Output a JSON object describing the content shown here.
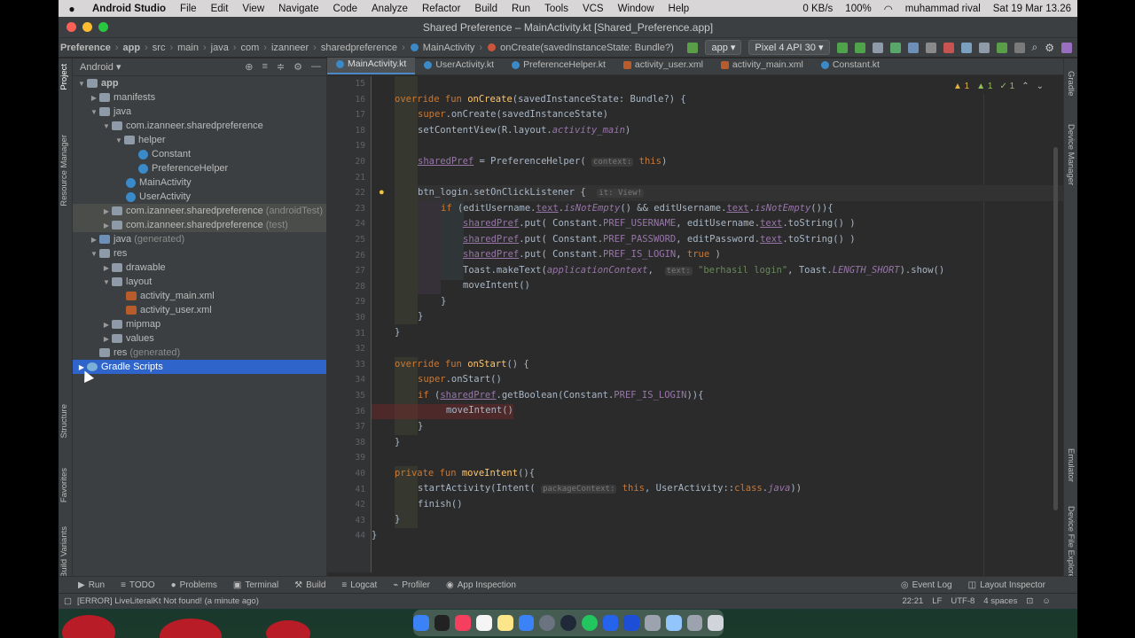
{
  "menubar": {
    "app": "Android Studio",
    "items": [
      "File",
      "Edit",
      "View",
      "Navigate",
      "Code",
      "Analyze",
      "Refactor",
      "Build",
      "Run",
      "Tools",
      "VCS",
      "Window",
      "Help"
    ],
    "net": "0 KB/s",
    "battery": "100%",
    "user": "muhammad rival",
    "datetime": "Sat 19 Mar  13.26"
  },
  "window": {
    "title": "Shared Preference – MainActivity.kt [Shared_Preference.app]"
  },
  "breadcrumbs": [
    "Preference",
    "app",
    "src",
    "main",
    "java",
    "com",
    "izanneer",
    "sharedpreference",
    "MainActivity",
    "onCreate(savedInstanceState: Bundle?)"
  ],
  "toolbar": {
    "config": "app",
    "device": "Pixel 4 API 30"
  },
  "left_strip": [
    "Project",
    "Resource Manager",
    "Structure",
    "Favorites",
    "Build Variants"
  ],
  "right_strip": [
    "Gradle",
    "Device Manager",
    "Emulator",
    "Device File Explorer"
  ],
  "project": {
    "view": "Android",
    "tree": [
      {
        "label": "app",
        "bold": true
      },
      {
        "label": "manifests"
      },
      {
        "label": "java"
      },
      {
        "label": "com.izanneer.sharedpreference"
      },
      {
        "label": "helper"
      },
      {
        "label": "Constant"
      },
      {
        "label": "PreferenceHelper"
      },
      {
        "label": "MainActivity"
      },
      {
        "label": "UserActivity"
      },
      {
        "label": "com.izanneer.sharedpreference",
        "suffix": "(androidTest)"
      },
      {
        "label": "com.izanneer.sharedpreference",
        "suffix": "(test)"
      },
      {
        "label": "java",
        "suffix": "(generated)"
      },
      {
        "label": "res"
      },
      {
        "label": "drawable"
      },
      {
        "label": "layout"
      },
      {
        "label": "activity_main.xml"
      },
      {
        "label": "activity_user.xml"
      },
      {
        "label": "mipmap"
      },
      {
        "label": "values"
      },
      {
        "label": "res",
        "suffix": "(generated)"
      },
      {
        "label": "Gradle Scripts"
      }
    ]
  },
  "tabs": [
    "MainActivity.kt",
    "UserActivity.kt",
    "PreferenceHelper.kt",
    "activity_user.xml",
    "activity_main.xml",
    "Constant.kt"
  ],
  "inspection": {
    "warnings": "1",
    "weak": "1",
    "typos": "1"
  },
  "code": {
    "line_numbers": [
      "15",
      "16",
      "17",
      "18",
      "19",
      "20",
      "21",
      "22",
      "23",
      "24",
      "25",
      "26",
      "27",
      "28",
      "29",
      "30",
      "31",
      "32",
      "33",
      "34",
      "35",
      "36",
      "37",
      "38",
      "39",
      "40",
      "41",
      "42",
      "43",
      "44"
    ],
    "l16": [
      "override fun ",
      "onCreate",
      "(savedInstanceState: Bundle?) {"
    ],
    "l17": [
      "super",
      ".onCreate(savedInstanceState)"
    ],
    "l18": [
      "setContentView(R.layout.",
      "activity_main",
      ")"
    ],
    "l20": [
      "sharedPref",
      " = PreferenceHelper( ",
      "context:",
      " this",
      ")"
    ],
    "l22": [
      "btn_login.setOnClickListener {",
      "it: View!"
    ],
    "l23": [
      "if",
      " (editUsername.",
      "text",
      ".",
      "isNotEmpty",
      "() && editUsername.",
      "text",
      ".",
      "isNotEmpty",
      "()){"
    ],
    "l24": [
      "sharedPref",
      ".put( Constant.",
      "PREF_USERNAME",
      ", editUsername.",
      "text",
      ".toString() )"
    ],
    "l25": [
      "sharedPref",
      ".put( Constant.",
      "PREF_PASSWORD",
      ", editPassword.",
      "text",
      ".toString() )"
    ],
    "l26": [
      "sharedPref",
      ".put( Constant.",
      "PREF_IS_LOGIN",
      ", ",
      "true",
      " )"
    ],
    "l27": [
      "Toast.makeText(",
      "applicationContext",
      ",",
      "text:",
      " \"berhasil login\"",
      ", Toast.",
      "LENGTH_SHORT",
      ").show()"
    ],
    "l28": [
      "moveIntent()"
    ],
    "l29": [
      "}"
    ],
    "l30": [
      "}"
    ],
    "l31": [
      "}"
    ],
    "l33": [
      "override fun ",
      "onStart",
      "() {"
    ],
    "l34": [
      "super",
      ".onStart()"
    ],
    "l35": [
      "if",
      " (",
      "sharedPref",
      ".getBoolean(Constant.",
      "PREF_IS_LOGIN",
      ")){"
    ],
    "l36": [
      "moveIntent()"
    ],
    "l37": [
      "}"
    ],
    "l38": [
      "}"
    ],
    "l40": [
      "private fun ",
      "moveIntent",
      "(){"
    ],
    "l41": [
      "startActivity(Intent(",
      "packageContext:",
      " this",
      ", UserActivity::",
      "class",
      ".",
      "java",
      "))"
    ],
    "l42": [
      "finish()"
    ],
    "l43": [
      "}"
    ],
    "l44": [
      "}"
    ]
  },
  "toolwindows": [
    "Run",
    "TODO",
    "Problems",
    "Terminal",
    "Build",
    "Logcat",
    "Profiler",
    "App Inspection",
    "Event Log",
    "Layout Inspector"
  ],
  "status": {
    "message": "[ERROR] LiveLiteralKt Not found! (a minute ago)",
    "position": "22:21",
    "line_sep": "LF",
    "encoding": "UTF-8",
    "indent": "4 spaces"
  }
}
